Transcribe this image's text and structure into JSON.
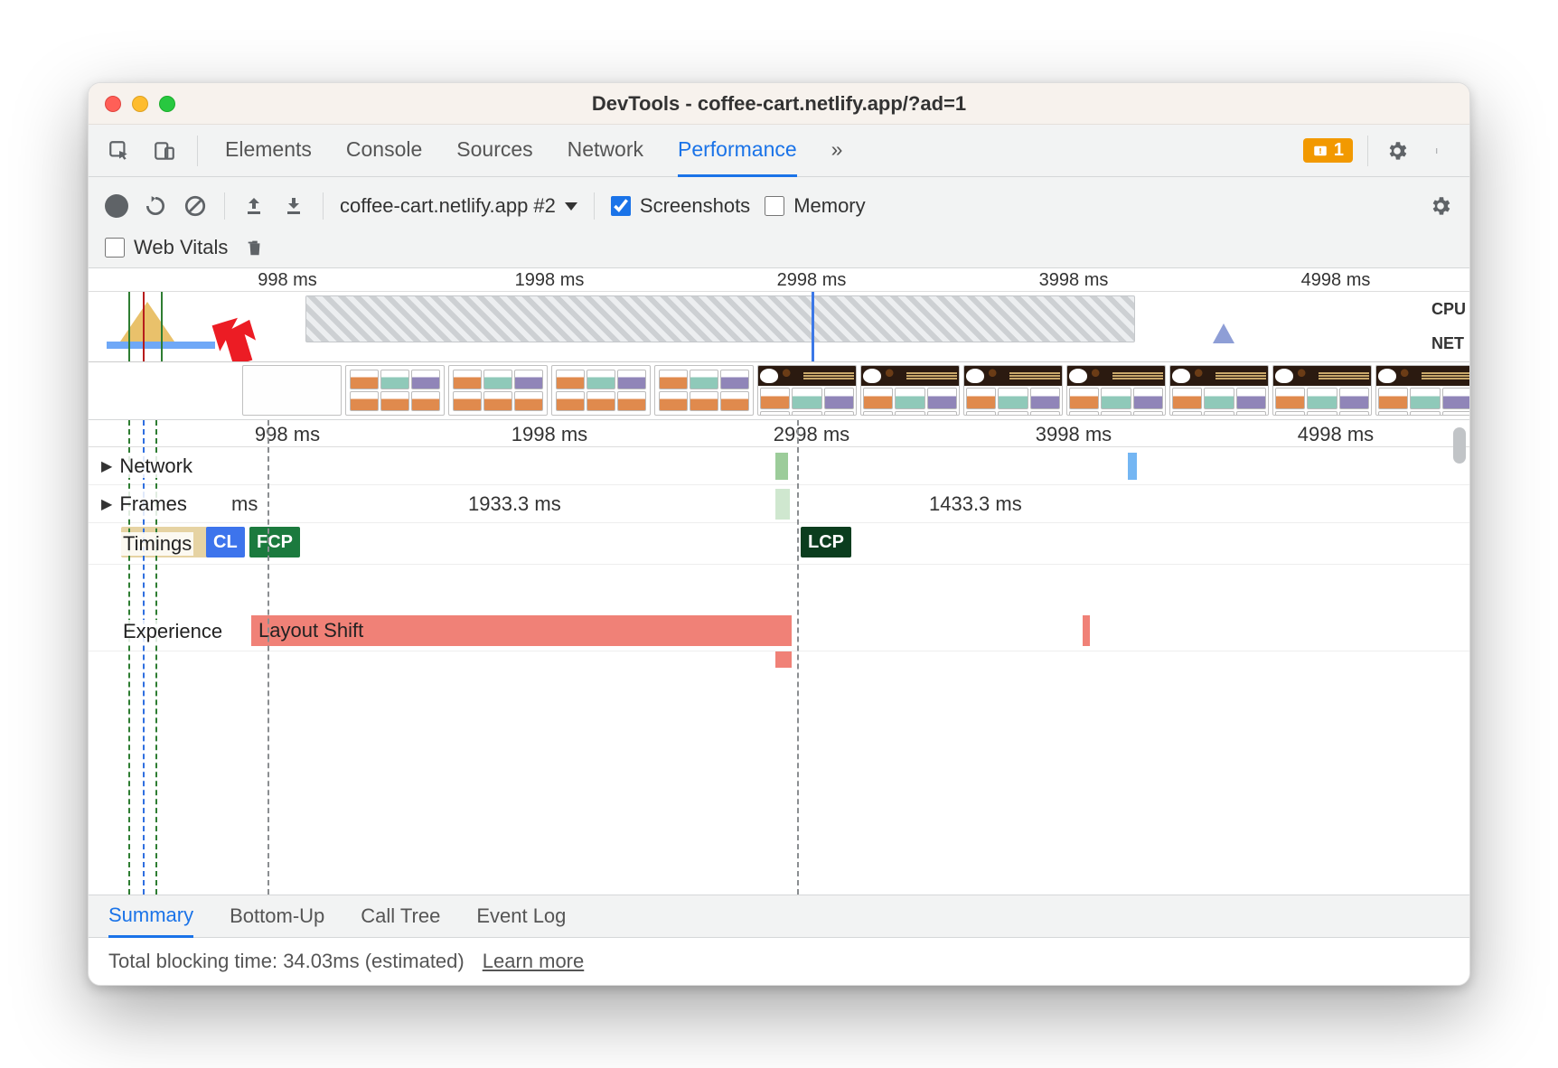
{
  "window": {
    "title": "DevTools - coffee-cart.netlify.app/?ad=1"
  },
  "tabs": {
    "elements": "Elements",
    "console": "Console",
    "sources": "Sources",
    "network": "Network",
    "performance": "Performance"
  },
  "badge": {
    "count": "1"
  },
  "perf": {
    "profile_name": "coffee-cart.netlify.app #2",
    "screenshots_label": "Screenshots",
    "memory_label": "Memory",
    "webvitals_label": "Web Vitals"
  },
  "ruler": {
    "t1": "998 ms",
    "t2": "1998 ms",
    "t3": "2998 ms",
    "t4": "3998 ms",
    "t5": "4998 ms"
  },
  "overview": {
    "cpu_label": "CPU",
    "net_label": "NET"
  },
  "tracks": {
    "network": "Network",
    "frames": "Frames",
    "frames_ms_a": "ms",
    "frames_ms_b": "1933.3 ms",
    "frames_ms_c": "1433.3 ms",
    "timings": "Timings",
    "cls": "CL",
    "fcp": "FCP",
    "lcp": "LCP",
    "experience": "Experience",
    "layout_shift": "Layout Shift"
  },
  "subtabs": {
    "summary": "Summary",
    "bottom": "Bottom-Up",
    "call": "Call Tree",
    "event": "Event Log"
  },
  "summary": {
    "text": "Total blocking time: 34.03ms (estimated)",
    "learn": "Learn more"
  }
}
